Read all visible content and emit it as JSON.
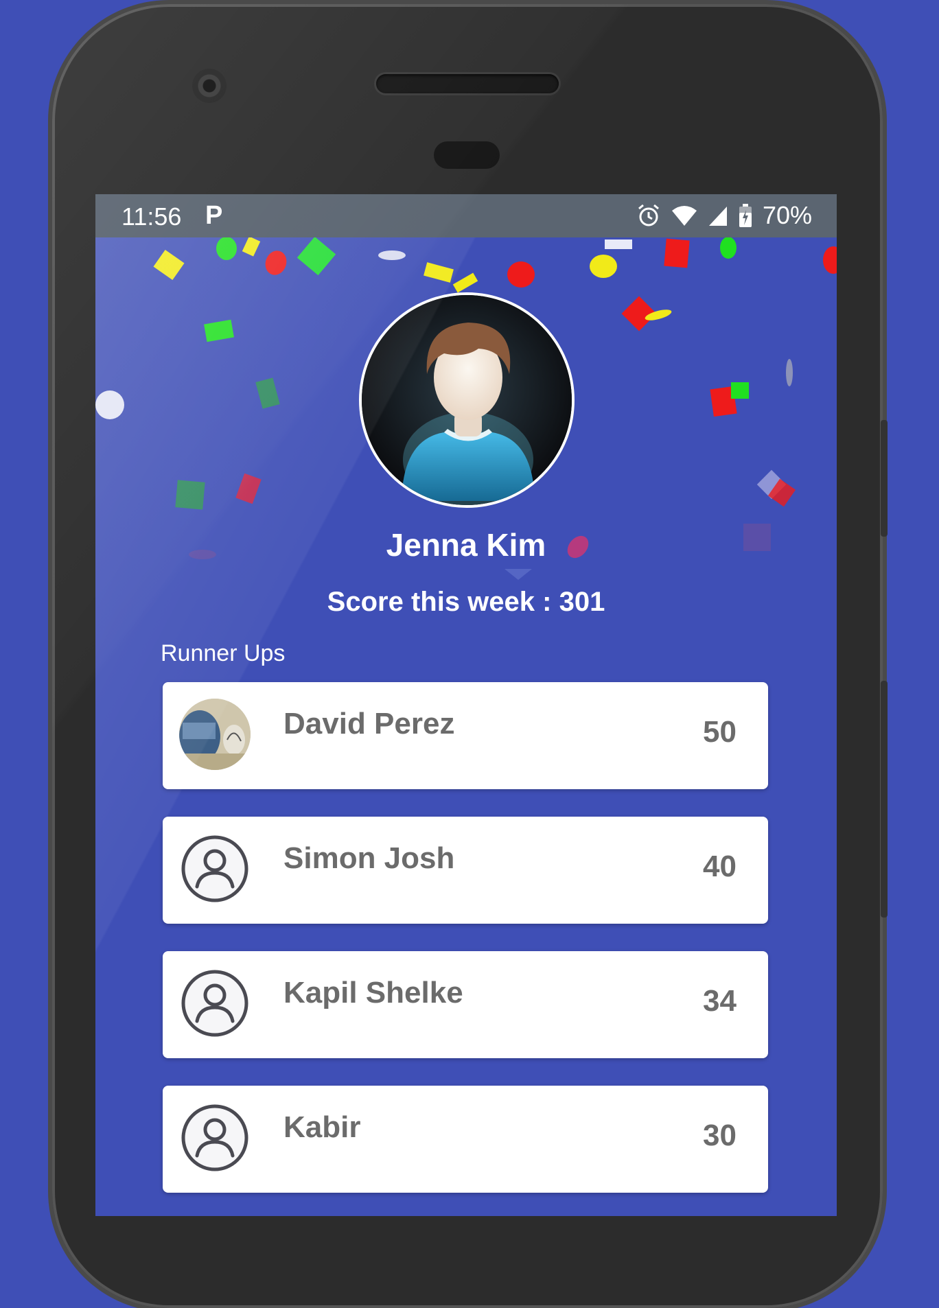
{
  "status_bar": {
    "time": "11:56",
    "notification_icon": "P",
    "battery": "70%",
    "icons": [
      "alarm-icon",
      "wifi-icon",
      "signal-icon",
      "battery-icon"
    ]
  },
  "winner": {
    "name": "Jenna Kim",
    "score_text": "Score this week : 301",
    "avatar": "default-user-photo"
  },
  "runner_ups": {
    "label": "Runner Ups",
    "items": [
      {
        "name": "David Perez",
        "score": "50",
        "avatar": "photo"
      },
      {
        "name": "Simon Josh",
        "score": "40",
        "avatar": "person-placeholder-icon"
      },
      {
        "name": "Kapil Shelke",
        "score": "34",
        "avatar": "person-placeholder-icon"
      },
      {
        "name": "Kabir",
        "score": "30",
        "avatar": "person-placeholder-icon"
      }
    ]
  },
  "colors": {
    "background": "#3f4fb6",
    "status_bar": "#5b6571",
    "card": "#ffffff",
    "card_text": "#6b6b6b"
  }
}
